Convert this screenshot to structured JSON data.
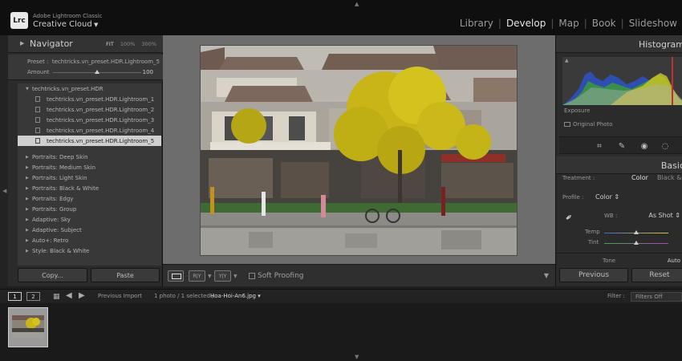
{
  "app": {
    "brand_small": "Adobe Lightroom Classic",
    "brand_big": "Creative Cloud",
    "logo": "Lrc"
  },
  "modules": [
    "Library",
    "Develop",
    "Map",
    "Book",
    "Slideshow"
  ],
  "active_module": "Develop",
  "navigator": {
    "title": "Navigator",
    "zoom": [
      "FIT",
      "100%",
      "300%"
    ]
  },
  "preset_info": {
    "label": "Preset :",
    "name": "techtricks.vn_preset.HDR.Lightroom_5",
    "amount_label": "Amount",
    "amount_value": "100",
    "amount_level": 100
  },
  "preset_folder": "techtricks.vn_preset.HDR",
  "presets": [
    "techtricks.vn_preset.HDR.Lightroom_1",
    "techtricks.vn_preset.HDR.Lightroom_2",
    "techtricks.vn_preset.HDR.Lightroom_3",
    "techtricks.vn_preset.HDR.Lightroom_4",
    "techtricks.vn_preset.HDR.Lightroom_5"
  ],
  "selected_preset": "techtricks.vn_preset.HDR.Lightroom_5",
  "preset_groups": [
    "Portraits: Deep Skin",
    "Portraits: Medium Skin",
    "Portraits: Light Skin",
    "Portraits: Black & White",
    "Portraits: Edgy",
    "Portraits: Group",
    "Adaptive: Sky",
    "Adaptive: Subject",
    "Auto+: Retro",
    "Style: Black & White"
  ],
  "left_buttons": {
    "copy": "Copy...",
    "paste": "Paste"
  },
  "toolbar": {
    "soft_proofing": "Soft Proofing",
    "compare_ry": "R|Y",
    "compare_yy": "Y|Y"
  },
  "histogram": {
    "title": "Histogram",
    "exposure": "Exposure",
    "original_photo": "Original Photo"
  },
  "basic": {
    "title": "Basic",
    "treatment_label": "Treatment :",
    "treatment_color": "Color",
    "treatment_bw": "Black & White",
    "profile_label": "Profile :",
    "profile_value": "Color",
    "wb_label": "WB :",
    "wb_value": "As Shot",
    "temp_label": "Temp",
    "tint_label": "Tint",
    "temp_level": 0.5,
    "tint_level": 0.5,
    "tone_label": "Tone",
    "tone_auto": "Auto"
  },
  "right_buttons": {
    "previous": "Previous",
    "reset": "Reset"
  },
  "filmstrip": {
    "page1": "1",
    "page2": "2",
    "source": "Previous Import",
    "count": "1 photo / 1 selected /",
    "filename": "Hoa-Hoi-An6.jpg",
    "filter_label": "Filter :",
    "filter_value": "Filters Off"
  },
  "colors": {
    "accent_panel": "#2b2b2b",
    "selected_row": "#cfcfcf",
    "background": "#1f1f1f"
  }
}
